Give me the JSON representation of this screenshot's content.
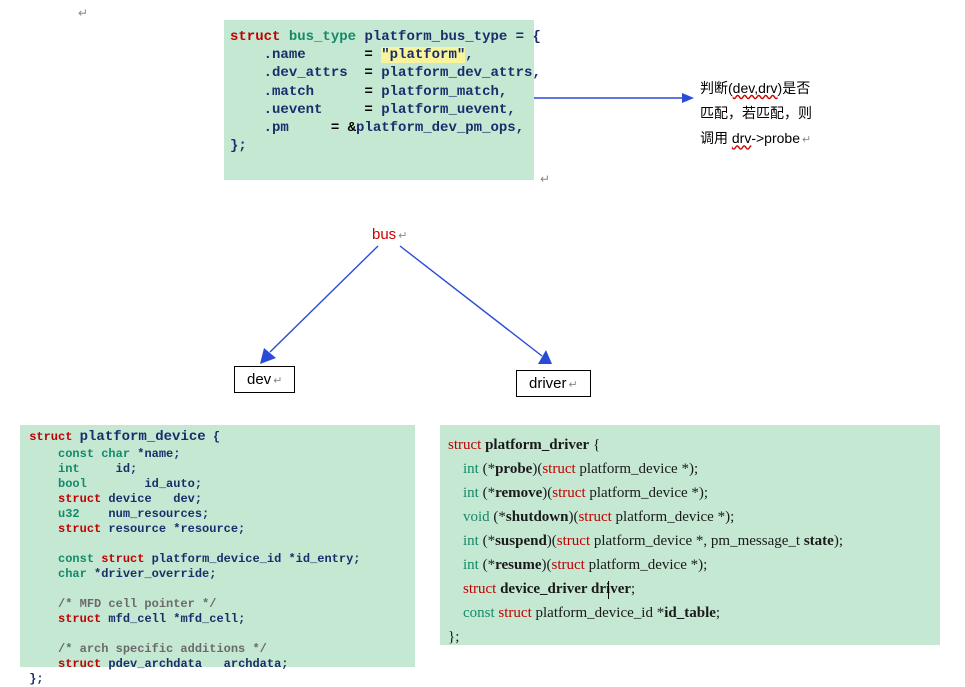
{
  "topCode": {
    "line1_kw": "struct",
    "line1_type": "bus_type",
    "line1_name": "platform_bus_type",
    "line1_eq": " = {",
    "name_field": ".name",
    "name_val": "\"platform\"",
    "dev_attrs_field": ".dev_attrs",
    "dev_attrs_val": "platform_dev_attrs",
    "match_field": ".match",
    "match_val": "platform_match",
    "uevent_field": ".uevent",
    "uevent_val": "platform_uevent",
    "pm_field": ".pm",
    "pm_val": "platform_dev_pm_ops",
    "close": "};"
  },
  "annotation": {
    "l1a": "判断(",
    "l1b": "dev,drv",
    "l1c": ")是否",
    "l2": "匹配，若匹配，则",
    "l3a": "调用 ",
    "l3b": "drv",
    "l3c": "->probe"
  },
  "labels": {
    "bus": "bus",
    "dev": "dev",
    "driver": "driver",
    "ret": "↵"
  },
  "devCode": {
    "l1a": "struct",
    "l1b": "platform_device",
    "l1c": " {",
    "l2a": "const char",
    "l2b": " *",
    "l2c": "name",
    "l2d": ";",
    "l3a": "int",
    "l3b": "     id;",
    "l4a": "bool",
    "l4b": "        id_auto;",
    "l5a": "struct",
    "l5b": " device",
    "l5c": "   dev;",
    "l6a": "u32",
    "l6b": "    num_resources;",
    "l7a": "struct",
    "l7b": " resource *resource;",
    "l8a": "const ",
    "l8b": "struct",
    "l8c": " platform_device_id *id_entry;",
    "l9a": "char",
    "l9b": " *driver_override;",
    "c1": "/* MFD cell pointer */",
    "l10a": "struct",
    "l10b": " mfd_cell *",
    "l10c": "mfd_cell",
    "l10d": ";",
    "c2": "/* arch specific additions */",
    "l11a": "struct",
    "l11b": " pdev_archdata",
    "l11c": "   archdata;",
    "close": "};"
  },
  "drvCode": {
    "l1a": "struct",
    "l1b": " platform_driver",
    "l1c": " {",
    "l2a": "int",
    "l2b": " (*",
    "l2c": "probe",
    "l2d": ")(",
    "l2e": "struct",
    "l2f": " platform_device *);",
    "l3a": "int",
    "l3b": " (*",
    "l3c": "remove",
    "l3d": ")(",
    "l3e": "struct",
    "l3f": " platform_device *);",
    "l4a": "void",
    "l4b": " (*",
    "l4c": "shutdown",
    "l4d": ")(",
    "l4e": "struct",
    "l4f": " platform_device *);",
    "l5a": "int",
    "l5b": " (*",
    "l5c": "suspend",
    "l5d": ")(",
    "l5e": "struct",
    "l5f": " platform_device *, pm_message_t ",
    "l5g": "state",
    "l5h": ");",
    "l6a": "int",
    "l6b": " (*",
    "l6c": "resume",
    "l6d": ")(",
    "l6e": "struct",
    "l6f": " platform_device *);",
    "l7a": "struct",
    "l7b": " device_driver ",
    "l7c": "driver",
    "l7d": ";",
    "l8a": "const ",
    "l8b": "struct",
    "l8c": " platform_device_id *",
    "l8d": "id_table",
    "l8e": ";",
    "close": "};"
  }
}
